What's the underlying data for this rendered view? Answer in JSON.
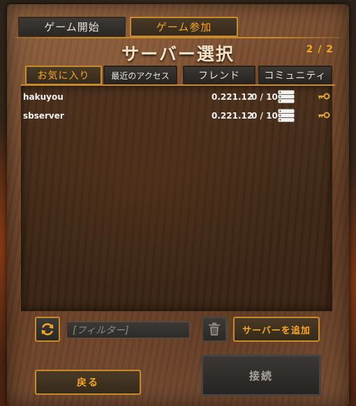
{
  "top_tabs": {
    "start_game": "ゲーム開始",
    "join_game": "ゲーム参加"
  },
  "title": "サーバー選択",
  "page_indicator": "2 / 2",
  "sub_tabs": {
    "favorites": "お気に入り",
    "recent": "最近のアクセス",
    "friends": "フレンド",
    "community": "コミュニティ"
  },
  "servers": [
    {
      "name": "hakuyou",
      "version": "0.221.12",
      "players": "0 / 10",
      "icons": [
        "server-icon",
        "key-icon"
      ]
    },
    {
      "name": "sbserver",
      "version": "0.221.12",
      "players": "0 / 10",
      "icons": [
        "server-icon",
        "key-icon"
      ]
    }
  ],
  "filter": {
    "placeholder": "[フィルター]",
    "value": ""
  },
  "buttons": {
    "add_server": "サーバーを追加",
    "back": "戻る",
    "connect": "接続"
  },
  "colors": {
    "accent": "#f5a623",
    "border_accent": "#c98a2a",
    "disabled_text": "#a8a29c"
  }
}
